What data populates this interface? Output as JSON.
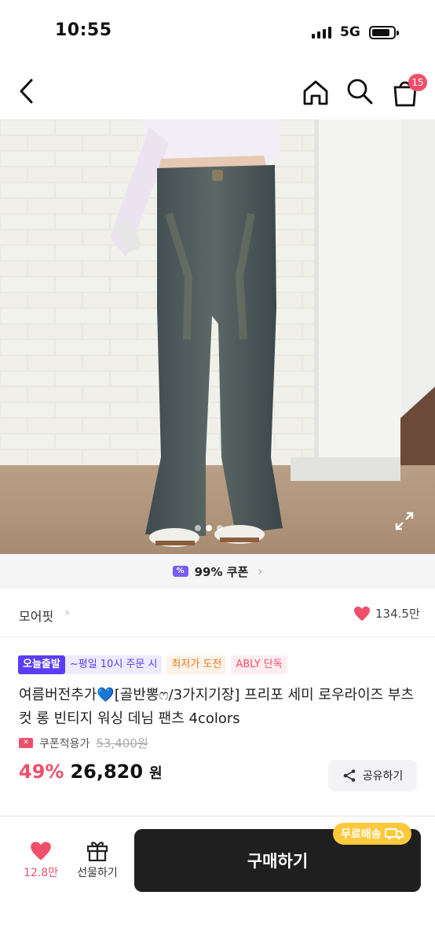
{
  "status_bar": {
    "time": "10:55",
    "network": "5G"
  },
  "header": {
    "cart_badge": "15"
  },
  "hero": {
    "image_index": 2,
    "image_count": 3
  },
  "coupon_bar": {
    "text": "99% 쿠폰"
  },
  "brand": {
    "name": "모어핏",
    "likes": "134.5만"
  },
  "tags": {
    "today": "오늘출발",
    "weekday": "~평일 10시 주문 시",
    "lowest": "최저가 도전",
    "ably": "ABLY 단독"
  },
  "product": {
    "title": "여름버전추가💙[골반뽕ෆ/3가지기장] 프리포 세미 로우라이즈 부츠컷 롱 빈티지 워싱 데님 팬츠 4colors",
    "coupon_label": "쿠폰적용가",
    "original_price": "53,400원",
    "discount": "49%",
    "price": "26,820",
    "currency": "원",
    "share_label": "공유하기"
  },
  "bottom_bar": {
    "wish_count": "12.8만",
    "gift_label": "선물하기",
    "buy_label": "구매하기",
    "shipping_badge": "무료배송"
  },
  "colors": {
    "accent": "#f04f6b",
    "brand_purple": "#5b3df5",
    "buy_button": "#1f1f1f",
    "shipping_badge": "#ffc93c"
  },
  "icons": [
    "chevron-left-icon",
    "home-icon",
    "search-icon",
    "shopping-bag-icon",
    "expand-icon",
    "heart-icon",
    "gift-icon",
    "share-icon",
    "truck-icon",
    "coupon-icon",
    "ticket-icon",
    "chevron-right-icon"
  ]
}
